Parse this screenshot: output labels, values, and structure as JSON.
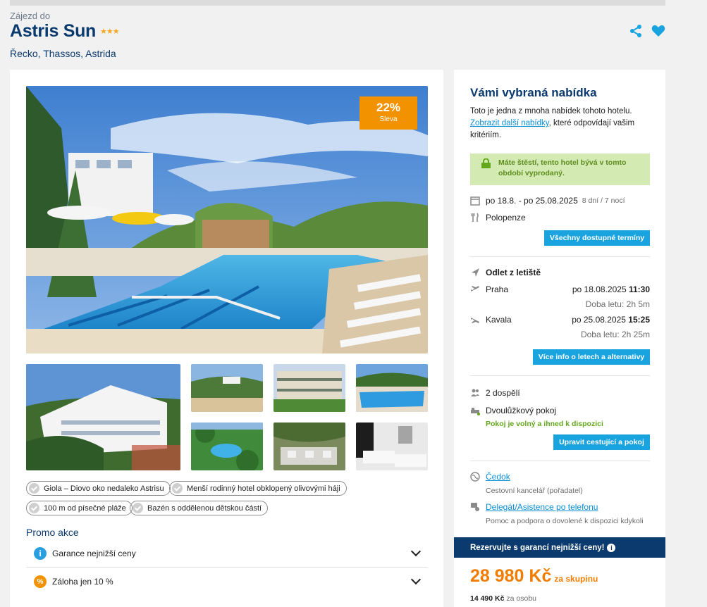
{
  "header": {
    "subtitle": "Zájezd do",
    "hotel_name": "Astris Sun",
    "stars": "★★★",
    "location": "Řecko, Thassos, Astrida",
    "icons": [
      "share-icon",
      "heart-icon"
    ]
  },
  "gallery": {
    "discount_percent": "22%",
    "discount_label": "Sleva"
  },
  "features": [
    "Giola – Diovo oko nedaleko Astrisu",
    "Menší rodinný hotel obklopený olivovými háji",
    "100 m od písečné pláže",
    "Bazén s oddělenou dětskou částí"
  ],
  "promo": {
    "title": "Promo akce",
    "items": [
      {
        "label": "Garance nejnižší ceny",
        "icon": "info-icon",
        "color": "#2a9fe0"
      },
      {
        "label": "Záloha jen 10 %",
        "icon": "percent-icon",
        "color": "#f39200"
      }
    ]
  },
  "offer": {
    "title": "Vámi vybraná nabídka",
    "intro_text": "Toto je jedna z mnoha nabídek tohoto hotelu.",
    "intro_link": "Zobrazit další nabídky",
    "intro_rest": ", které odpovídají vašim kritériím.",
    "lucky_text": "Máte štěstí, tento hotel bývá v tomto období vyprodaný.",
    "dates": "po 18.8. - po 25.08.2025",
    "duration": "8 dní / 7 nocí",
    "board": "Polopenze",
    "all_dates_button": "Všechny dostupné termíny",
    "departure_heading": "Odlet z letiště",
    "outbound_city": "Praha",
    "outbound_date": "po 18.08.2025",
    "outbound_time": "11:30",
    "outbound_duration": "Doba letu: 2h 5m",
    "return_city": "Kavala",
    "return_date": "po 25.08.2025",
    "return_time": "15:25",
    "return_duration": "Doba letu: 2h 25m",
    "flights_button": "Více info o letech a alternativy",
    "travellers": "2 dospělí",
    "room": "Dvoulůžkový pokoj",
    "room_status": "Pokoj je volný a ihned k dispozici",
    "edit_button": "Upravit cestující a pokoj",
    "organizer_name": "Čedok",
    "organizer_role": "Cestovní kancelář (pořadatel)",
    "support_name": "Delegát/Asistence po telefonu",
    "support_desc": "Pomoc a podpora o dovolené k dispozici kdykoli"
  },
  "pricing": {
    "banner": "Rezervujte s garancí nejnižší ceny!",
    "total": "28 980 Kč",
    "total_unit": "za skupinu",
    "per_person_value": "14 490 Kč",
    "per_person_unit": "za osobu"
  },
  "colors": {
    "brand_navy": "#0b3a6e",
    "accent_blue": "#19a3df",
    "price_orange": "#f07d00",
    "success_green": "#62a818"
  }
}
